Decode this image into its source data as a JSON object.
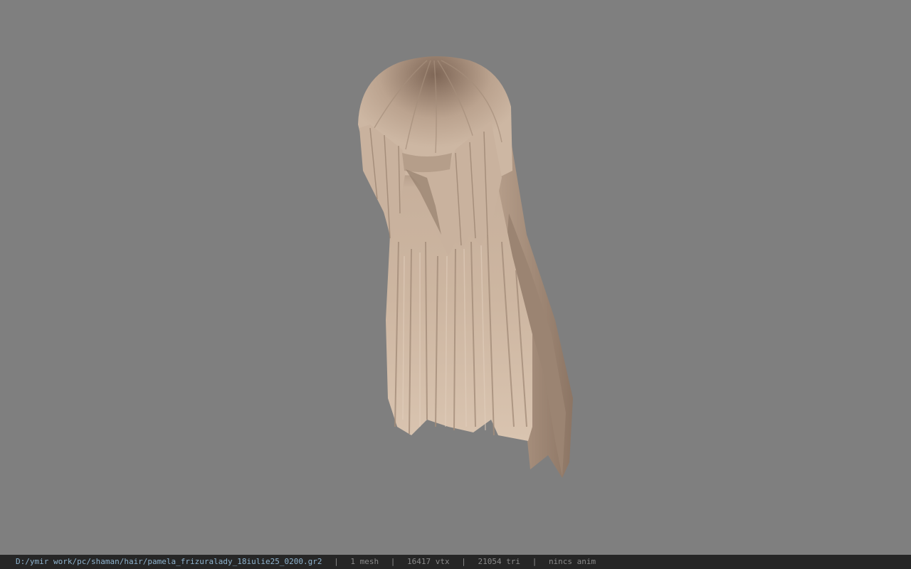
{
  "status_bar": {
    "file_path": "D:/ymir work/pc/shaman/hair/pamela_frizuralady_18iulie25_0200.gr2",
    "separator": "|",
    "mesh_count": "1 mesh",
    "vertex_count": "16417 vtx",
    "triangle_count": "21054 tri",
    "anim_status": "nincs anim"
  },
  "colors": {
    "viewport_background": "#7f7f7f",
    "statusbar_background": "#262626",
    "path_text": "#8fb4cf",
    "stat_text": "#8a8a8a",
    "hair_light": "#d8c2ad",
    "hair_dark": "#8a7361"
  }
}
